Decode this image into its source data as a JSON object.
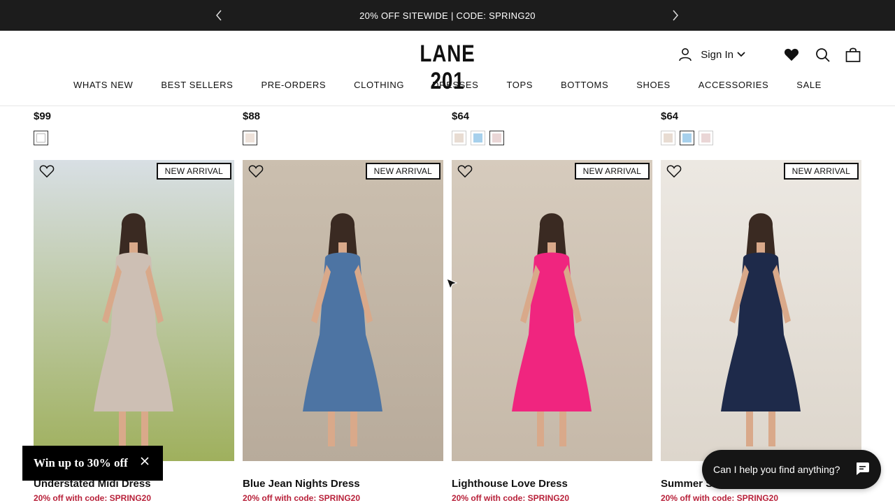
{
  "announcement": {
    "text": "20% OFF SITEWIDE | CODE: SPRING20",
    "prev_icon": "chevron-left-icon",
    "next_icon": "chevron-right-icon"
  },
  "header": {
    "logo": "LANE 201",
    "sign_in": "Sign In",
    "icons": [
      "account-icon",
      "chevron-down-icon",
      "heart-icon",
      "search-icon",
      "bag-icon"
    ]
  },
  "nav": [
    "WHATS NEW",
    "BEST SELLERS",
    "PRE-ORDERS",
    "CLOTHING",
    "DRESSES",
    "TOPS",
    "BOTTOMS",
    "SHOES",
    "ACCESSORIES",
    "SALE"
  ],
  "previous_row": [
    {
      "price": "$99",
      "swatches": [
        "#ffffff"
      ],
      "selected": 0
    },
    {
      "price": "$88",
      "swatches": [
        "#eee2da"
      ],
      "selected": 0
    },
    {
      "price": "$64",
      "swatches": [
        "#e8dcd2",
        "#a7d0ec",
        "#ead6d6"
      ],
      "selected": 2
    },
    {
      "price": "$64",
      "swatches": [
        "#e8dcd2",
        "#a7d0ec",
        "#ead6d6"
      ],
      "selected": 1
    }
  ],
  "products": [
    {
      "badge": "NEW ARRIVAL",
      "title": "Understated Midi Dress",
      "promo": "20% off with code: SPRING20",
      "dress_color": "#cdbfb4",
      "bg_top": "#d8dfe4",
      "bg_bottom": "#9fb05d"
    },
    {
      "badge": "NEW ARRIVAL",
      "title": "Blue Jean Nights Dress",
      "promo": "20% off with code: SPRING20",
      "dress_color": "#4d74a3",
      "bg_top": "#cbbfaf",
      "bg_bottom": "#b8ab9b"
    },
    {
      "badge": "NEW ARRIVAL",
      "title": "Lighthouse Love Dress",
      "promo": "20% off with code: SPRING20",
      "dress_color": "#f0257f",
      "bg_top": "#d6cbbd",
      "bg_bottom": "#c6b9a9"
    },
    {
      "badge": "NEW ARRIVAL",
      "title": "Summer S",
      "promo": "20% off with code: SPRING20",
      "dress_color": "#1e2a4a",
      "bg_top": "#ece8e2",
      "bg_bottom": "#ddd6cc"
    }
  ],
  "popup": {
    "text": "Win up to 30% off",
    "close_icon": "close-icon"
  },
  "chat": {
    "text": "Can I help you find anything?",
    "icon": "chat-bubble-icon"
  },
  "colors": {
    "announcement_bg": "#1c1c1c",
    "promo_red": "#b8213a",
    "chat_bg": "#151515"
  }
}
